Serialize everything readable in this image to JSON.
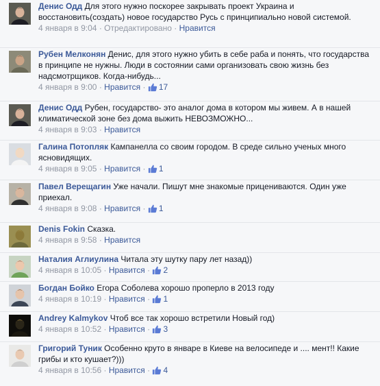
{
  "like_label": "Нравится",
  "separator": "·",
  "comments": [
    {
      "author": "Денис Одд",
      "text": "Для этого нужно поскорее закрывать проект Украина и восстановить(создать) новое государство Русь с принципиально новой системой.",
      "date": "4 января в 9:04",
      "edited": "Отредактировано",
      "likes": ""
    },
    {
      "author": "Рубен Мелконян",
      "text": "Денис, для этого нужно убить в себе раба и понять, что государства в принципе не нужны. Люди в состоянии сами организовать свою жизнь без надсмотрщиков. Когда-нибудь...",
      "date": "4 января в 9:00",
      "edited": "",
      "likes": "17"
    },
    {
      "author": "Денис Одд",
      "text": "Рубен, государство- это аналог дома в котором мы живем. А в нашей климатической зоне без дома выжить НЕВОЗМОЖНО...",
      "date": "4 января в 9:03",
      "edited": "",
      "likes": ""
    },
    {
      "author": "Галина Потопляк",
      "text": "Кампанелла со своим городом. В среде сильно ученых много ясновидящих.",
      "date": "4 января в 9:05",
      "edited": "",
      "likes": "1"
    },
    {
      "author": "Павел Верещагин",
      "text": "Уже начали. Пишут мне знакомые прицениваются. Один уже приехал.",
      "date": "4 января в 9:08",
      "edited": "",
      "likes": "1"
    },
    {
      "author": "Denis Fokin",
      "text": "Сказка.",
      "date": "4 января в 9:58",
      "edited": "",
      "likes": ""
    },
    {
      "author": "Наталия Аглиулина",
      "text": "Читала эту шутку пару лет назад))",
      "date": "4 января в 10:05",
      "edited": "",
      "likes": "2"
    },
    {
      "author": "Богдан Бойко",
      "text": "Егора Соболева хорошо проперло в 2013 году",
      "date": "4 января в 10:19",
      "edited": "",
      "likes": "1"
    },
    {
      "author": "Andrey Kalmykov",
      "text": "Чтоб все так хорошо встретили Новый год)",
      "date": "4 января в 10:52",
      "edited": "",
      "likes": "3"
    },
    {
      "author": "Григорий Туник",
      "text": "Особенно круто в январе в Киеве на велосипеде и .... мент!! Какие грибы и кто кушает?)))",
      "date": "4 января в 10:56",
      "edited": "",
      "likes": "4"
    }
  ]
}
